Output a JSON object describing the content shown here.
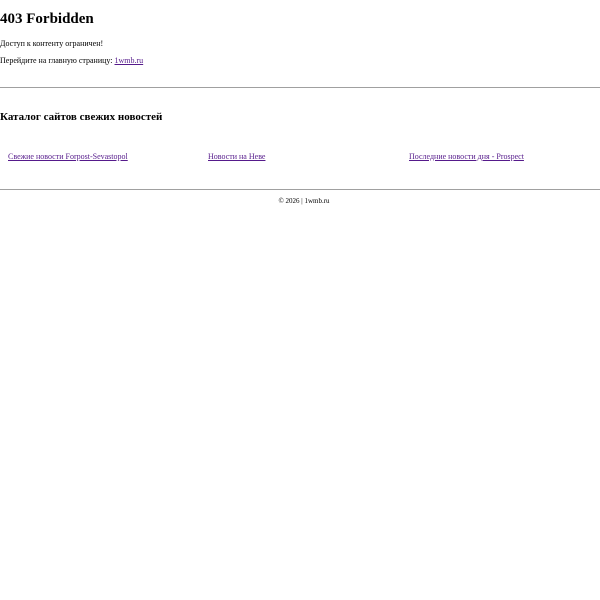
{
  "header": {
    "title": "403 Forbidden",
    "access_message": "Доступ к контенту ограничен!",
    "goto_prefix": "Перейдите на главную страницу:",
    "goto_link": "1wmb.ru"
  },
  "catalog": {
    "title": "Каталог сайтов свежих новостей",
    "links": [
      "Свежие новости Forpost-Sevastopol",
      "Новости на Неве",
      "Последние новости дня - Prospect"
    ]
  },
  "footer": {
    "copyright": "© 2026",
    "separator": "|",
    "site": "1wmb.ru"
  },
  "colors": {
    "link": "#551a8b",
    "rule": "#a0a0a0",
    "background": "#ffffff",
    "text": "#000000"
  }
}
